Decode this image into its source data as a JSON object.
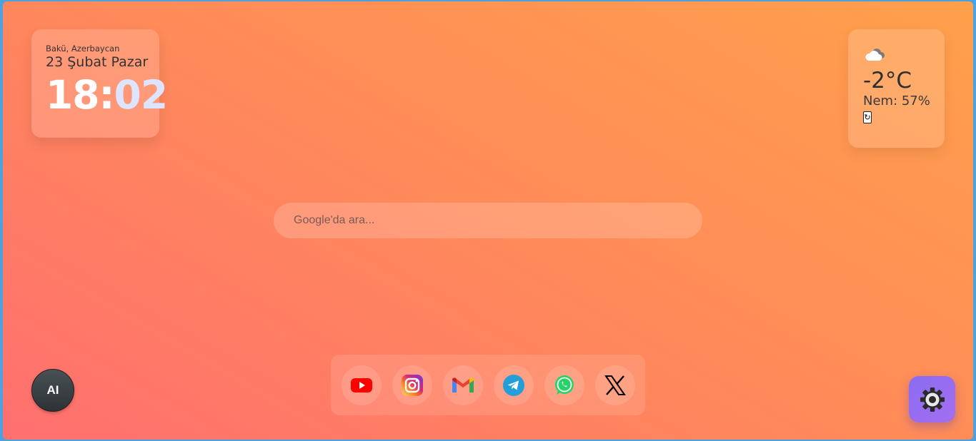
{
  "clock": {
    "location": "Bakü, Azerbaycan",
    "date": "23 Şubat Pazar",
    "hours": "18",
    "separator": ":",
    "minutes": "02"
  },
  "weather": {
    "icon": "cloud-icon",
    "temperature": "-2°C",
    "humidity": "Nem: 57%",
    "refresh_label": "↻"
  },
  "search": {
    "placeholder": "Google'da ara..."
  },
  "apps": [
    {
      "name": "YouTube",
      "icon": "youtube-icon",
      "color": "#ff0000"
    },
    {
      "name": "Instagram",
      "icon": "instagram-icon",
      "color": "#d62976"
    },
    {
      "name": "Gmail",
      "icon": "gmail-icon",
      "color": "#ea4335"
    },
    {
      "name": "Telegram",
      "icon": "telegram-icon",
      "color": "#229ed9"
    },
    {
      "name": "WhatsApp",
      "icon": "whatsapp-icon",
      "color": "#25d366"
    },
    {
      "name": "X",
      "icon": "x-icon",
      "color": "#000000"
    }
  ],
  "ai_button": {
    "label": "AI"
  },
  "settings_button": {
    "icon": "gear-icon",
    "color": "#8f6cf0"
  }
}
